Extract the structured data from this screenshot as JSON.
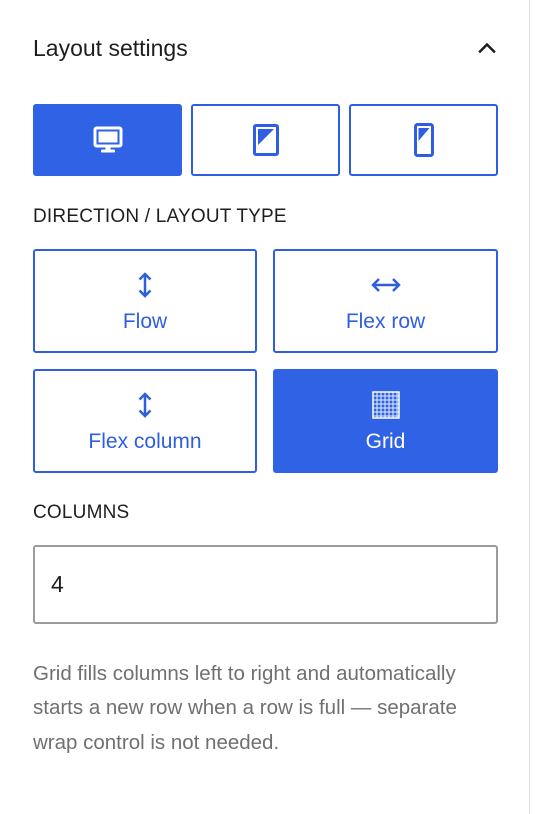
{
  "panel": {
    "title": "Layout settings"
  },
  "icons": {
    "collapse": "chevron-up-icon",
    "desktop": "desktop-icon",
    "tablet": "tablet-icon",
    "mobile": "mobile-icon",
    "flow": "vertical-arrows-icon",
    "flex_row": "horizontal-arrows-icon",
    "flex_column": "vertical-arrows-icon",
    "grid": "grid-icon"
  },
  "devices": {
    "selected": "desktop"
  },
  "direction": {
    "label": "DIRECTION / LAYOUT TYPE",
    "selected": "Grid",
    "options": [
      {
        "label": "Flow"
      },
      {
        "label": "Flex row"
      },
      {
        "label": "Flex column"
      },
      {
        "label": "Grid"
      }
    ]
  },
  "columns": {
    "label": "COLUMNS",
    "value": "4"
  },
  "help": {
    "text": "Grid fills columns left to right and automatically starts a new row when a row is full — separate wrap control is not needed."
  },
  "colors": {
    "accent": "#2f62e4",
    "border": "#2f5fe0",
    "input_border": "#9b9b9b",
    "help_text": "#707070",
    "text": "#1e1e1e"
  }
}
